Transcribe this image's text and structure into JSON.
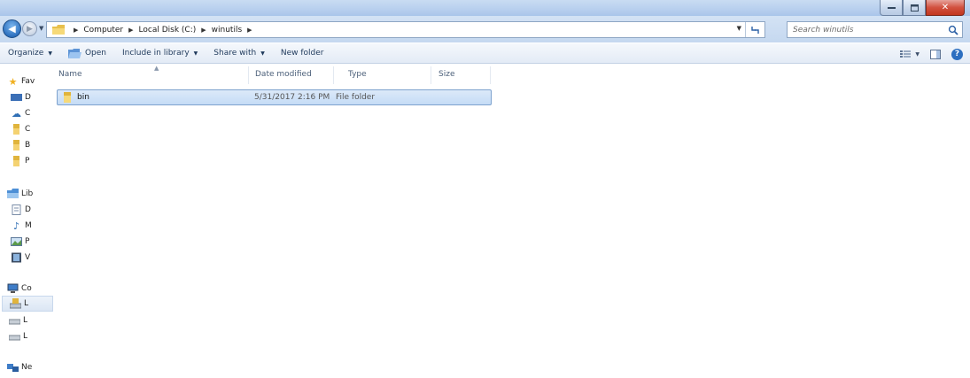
{
  "address": {
    "crumbs": [
      "Computer",
      "Local Disk (C:)",
      "winutils"
    ]
  },
  "search": {
    "placeholder": "Search winutils"
  },
  "toolbar": {
    "organize": "Organize",
    "open": "Open",
    "include": "Include in library",
    "share": "Share with",
    "newfolder": "New folder"
  },
  "navpane": {
    "favorites": "Fav",
    "fav_items": [
      "D",
      "C",
      "C",
      "B",
      "P"
    ],
    "libraries": "Lib",
    "lib_items": [
      "D",
      "M",
      "P",
      "V"
    ],
    "computer": "Co",
    "comp_items": [
      "L",
      "L",
      "L"
    ],
    "network": "Ne"
  },
  "columns": {
    "name": "Name",
    "date": "Date modified",
    "type": "Type",
    "size": "Size"
  },
  "files": [
    {
      "name": "bin",
      "date": "5/31/2017 2:16 PM",
      "type": "File folder",
      "size": ""
    }
  ],
  "colors": {
    "selection": "#c5dcf6",
    "accent": "#2f72c0"
  }
}
